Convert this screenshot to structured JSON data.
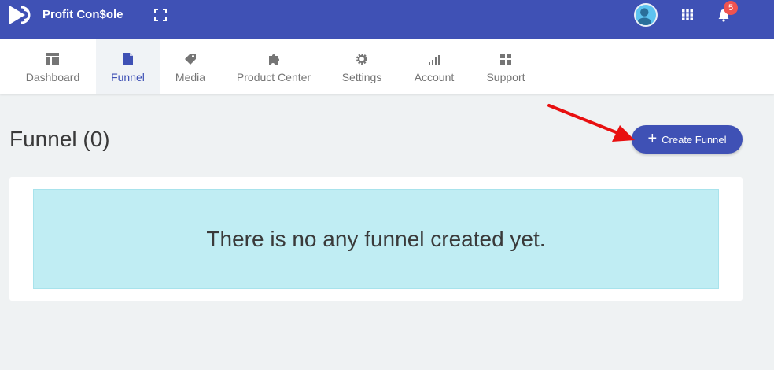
{
  "topbar": {
    "brand": "Profit Con$ole",
    "notification_count": "5",
    "icons": [
      "play-logo-icon",
      "fullscreen-icon",
      "user-avatar-icon",
      "apps-grid-icon",
      "bell-icon"
    ]
  },
  "nav": {
    "items": [
      {
        "label": "Dashboard",
        "icon": "dashboard-icon"
      },
      {
        "label": "Funnel",
        "icon": "file-icon",
        "active": true
      },
      {
        "label": "Media",
        "icon": "tag-icon"
      },
      {
        "label": "Product Center",
        "icon": "puzzle-icon"
      },
      {
        "label": "Settings",
        "icon": "gear-icon"
      },
      {
        "label": "Account",
        "icon": "signal-bars-icon"
      },
      {
        "label": "Support",
        "icon": "grid-icon"
      }
    ]
  },
  "page": {
    "title": "Funnel (0)",
    "create_button": "Create Funnel",
    "empty_message": "There is no any funnel created yet."
  },
  "colors": {
    "primary": "#3f51b5",
    "empty_bg": "#c0edf3",
    "badge": "#ef5350",
    "annotation_arrow": "#e81010"
  }
}
